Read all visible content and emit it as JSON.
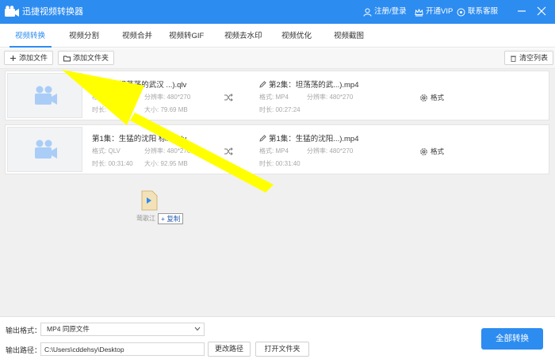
{
  "app": {
    "title": "迅捷视频转换器"
  },
  "titlebar": {
    "login": "注册/登录",
    "vip": "开通VIP",
    "support": "联系客服"
  },
  "tabs": [
    "视频转换",
    "视频分割",
    "视频合并",
    "视频转GIF",
    "视频去水印",
    "视频优化",
    "视频截图"
  ],
  "active_tab": 0,
  "toolbar": {
    "add_file": "添加文件",
    "add_folder": "添加文件夹",
    "clear_list": "清空列表"
  },
  "files": [
    {
      "source_name": "第2集：坦荡荡的武汉 ...).qlv",
      "source_format_label": "格式:",
      "source_format": "QLV",
      "source_res_label": "分辨率:",
      "source_res": "480*270",
      "source_duration_label": "时长:",
      "source_duration": "",
      "source_size_label": "大小:",
      "source_size": "79.69 MB",
      "target_name": "第2集：坦荡荡的武...).mp4",
      "target_format_label": "格式:",
      "target_format": "MP4",
      "target_res_label": "分辨率:",
      "target_res": "480*270",
      "target_duration_label": "时长:",
      "target_duration": "00:27:24",
      "format_button": "格式"
    },
    {
      "source_name": "第1集：生猛的沈阳 标...).qlv",
      "source_format_label": "格式:",
      "source_format": "QLV",
      "source_res_label": "分辨率:",
      "source_res": "480*270",
      "source_duration_label": "时长:",
      "source_duration": "00:31:40",
      "source_size_label": "大小:",
      "source_size": "92.95 MB",
      "target_name": "第1集：生猛的沈阳...).mp4",
      "target_format_label": "格式:",
      "target_format": "MP4",
      "target_res_label": "分辨率:",
      "target_res": "480*270",
      "target_duration_label": "时长:",
      "target_duration": "00:31:40",
      "format_button": "格式"
    }
  ],
  "drag": {
    "file_label": "莺歌江",
    "copy_tip": "+ 复制"
  },
  "bottom": {
    "output_format_label": "输出格式：",
    "output_format_value": "MP4   同原文件",
    "output_path_label": "输出路径：",
    "output_path_value": "C:\\Users\\cddehsy\\Desktop",
    "change_path": "更改路径",
    "open_folder": "打开文件夹",
    "convert_all": "全部转换"
  },
  "colors": {
    "accent": "#2d8cf0",
    "annotation_arrow": "#ffff00"
  }
}
